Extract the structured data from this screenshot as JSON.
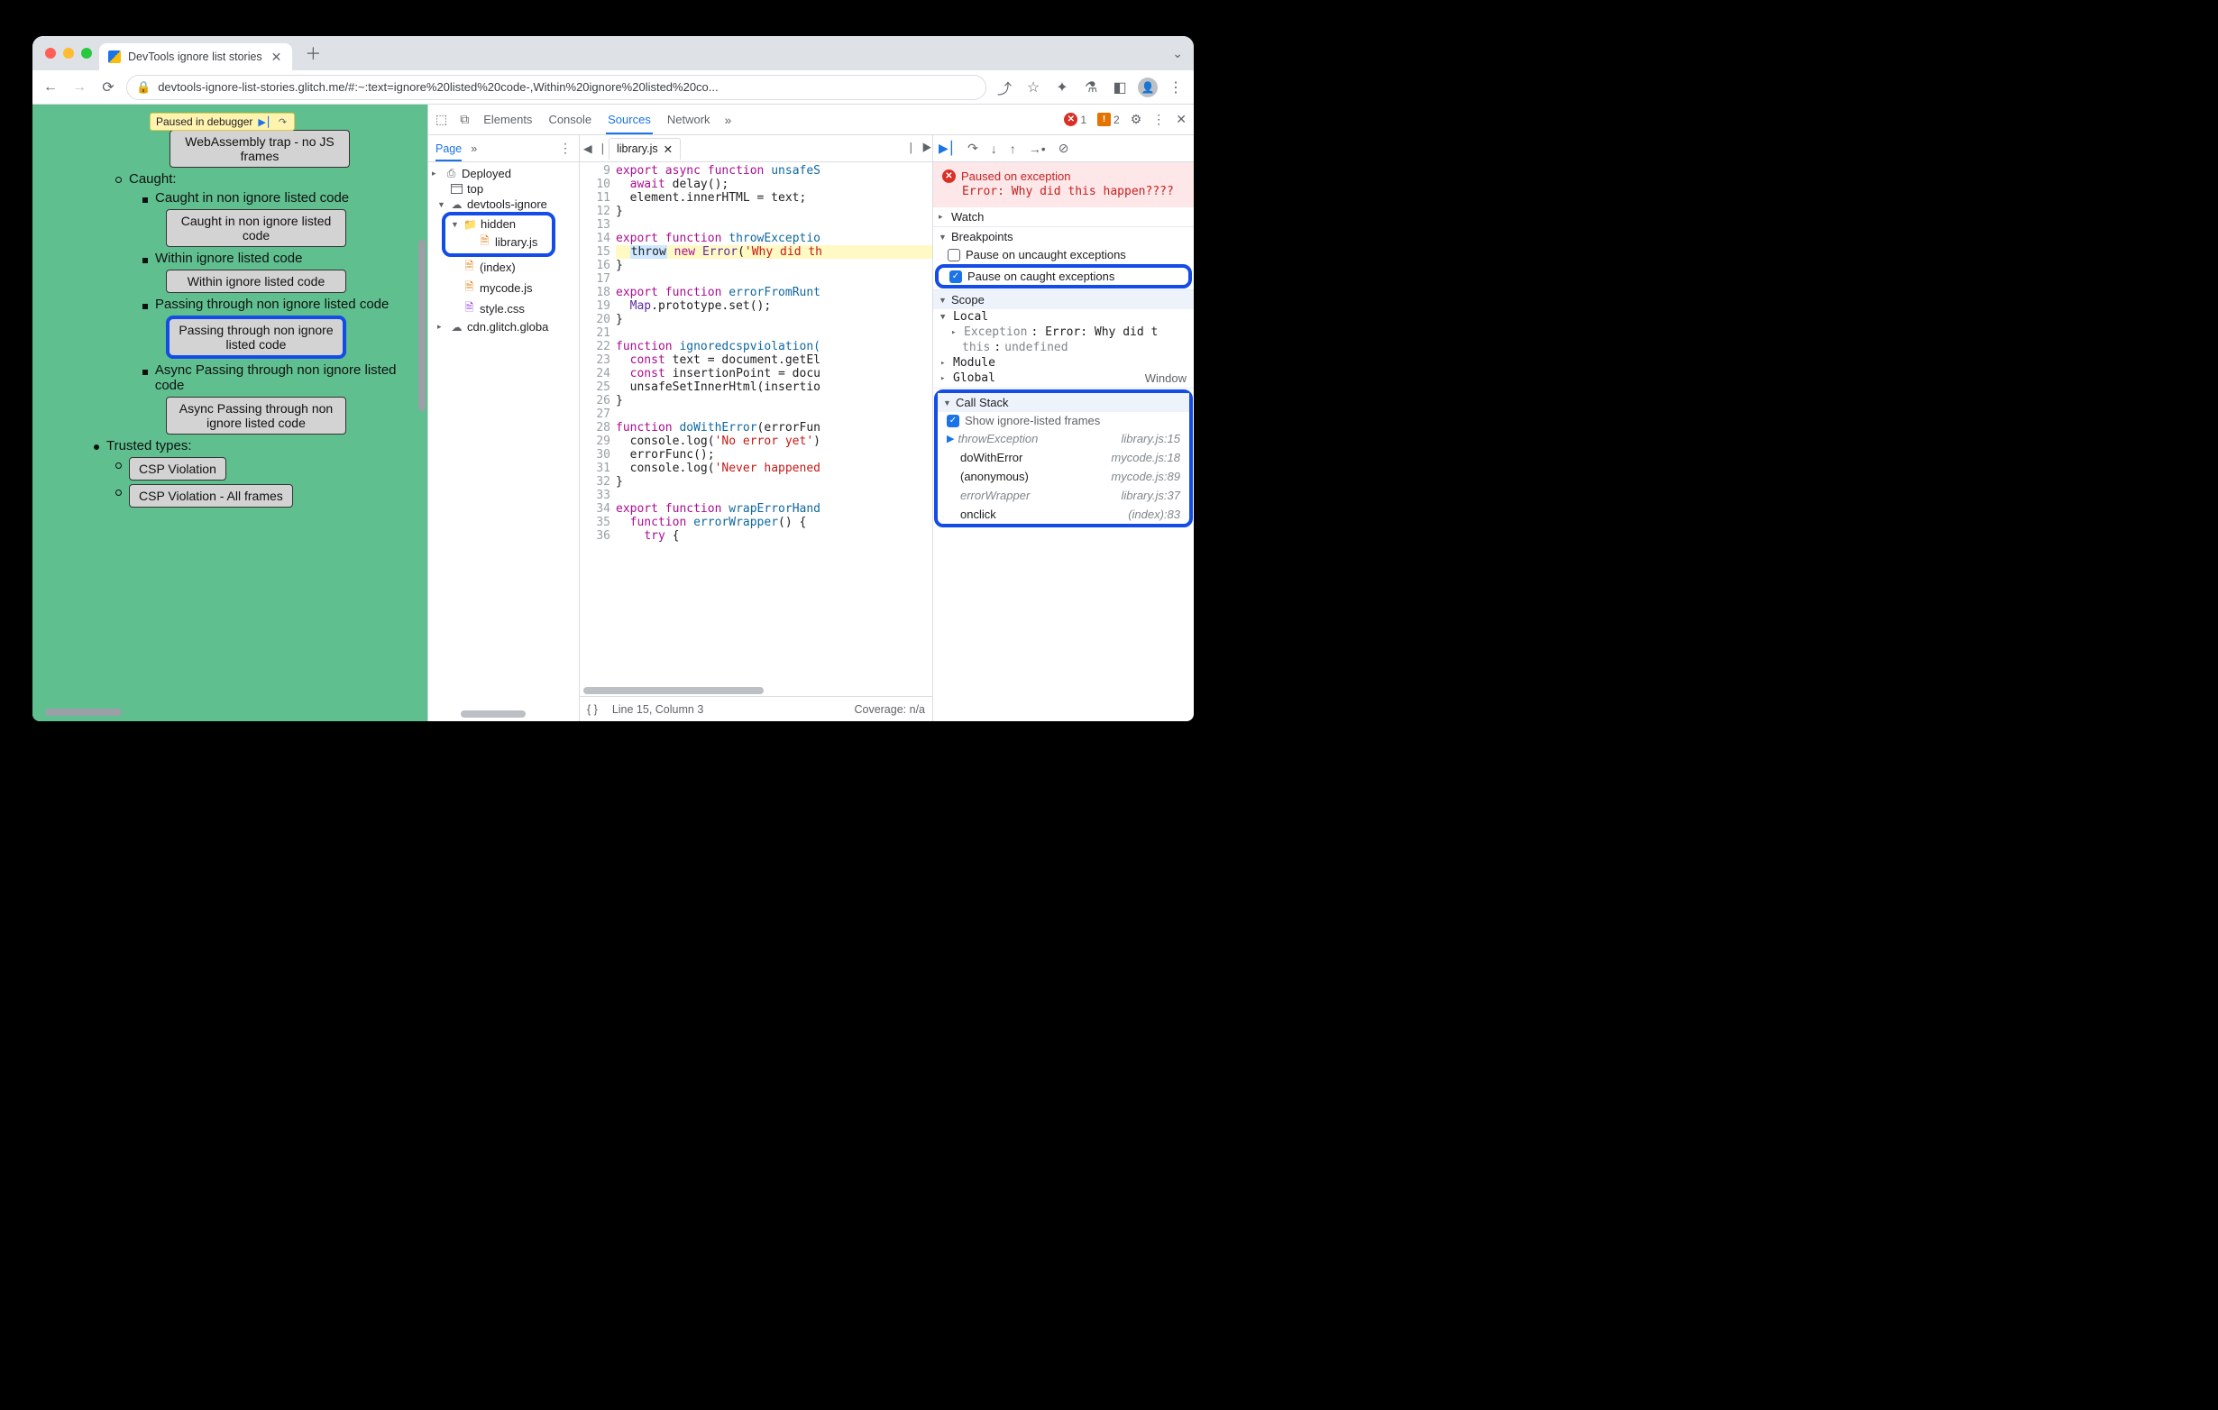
{
  "tab": {
    "title": "DevTools ignore list stories"
  },
  "url": "devtools-ignore-list-stories.glitch.me/#:~:text=ignore%20listed%20code-,Within%20ignore%20listed%20co...",
  "chip": {
    "text": "Paused in debugger"
  },
  "page": {
    "wasm": "WebAssembly trap - no JS frames",
    "caught": "Caught:",
    "l1": "Caught in non ignore listed code",
    "b1": "Caught in non ignore listed code",
    "l2": "Within ignore listed code",
    "b2": "Within ignore listed code",
    "l3": "Passing through non ignore listed code",
    "b3": "Passing through non ignore listed code",
    "l4": "Async Passing through non ignore listed code",
    "b4": "Async Passing through non ignore listed code",
    "tt": "Trusted types:",
    "b5": "CSP Violation",
    "b6": "CSP Violation - All frames"
  },
  "dtTabs": {
    "elements": "Elements",
    "console": "Console",
    "sources": "Sources",
    "network": "Network"
  },
  "errors": "1",
  "warnings": "2",
  "nav": {
    "page": "Page",
    "deployed": "Deployed",
    "top": "top",
    "domain": "devtools-ignore",
    "hidden": "hidden",
    "lib": "library.js",
    "index": "(index)",
    "mycode": "mycode.js",
    "style": "style.css",
    "cdn": "cdn.glitch.globa"
  },
  "editor": {
    "file": "library.js",
    "status_line": "Line 15, Column 3",
    "coverage": "Coverage: n/a",
    "lines": {
      "9": "export async function unsafeS",
      "10": "  await delay();",
      "11": "  element.innerHTML = text;",
      "12": "}",
      "13": "",
      "14": "export function throwExceptio",
      "15": "  throw new Error('Why did th",
      "16": "}",
      "17": "",
      "18": "export function errorFromRunt",
      "19": "  Map.prototype.set();",
      "20": "}",
      "21": "",
      "22": "function ignoredcspviolation(",
      "23": "  const text = document.getEl",
      "24": "  const insertionPoint = docu",
      "25": "  unsafeSetInnerHtml(insertio",
      "26": "}",
      "27": "",
      "28": "function doWithError(errorFun",
      "29": "  console.log('No error yet')",
      "30": "  errorFunc();",
      "31": "  console.log('Never happened",
      "32": "}",
      "33": "",
      "34": "export function wrapErrorHand",
      "35": "  function errorWrapper() {",
      "36": "    try {"
    }
  },
  "pause": {
    "title": "Paused on exception",
    "err": "Error: Why did this happen????"
  },
  "sections": {
    "watch": "Watch",
    "breakpoints": "Breakpoints",
    "scope": "Scope",
    "callstack": "Call Stack"
  },
  "bp": {
    "uncaught": "Pause on uncaught exceptions",
    "caught": "Pause on caught exceptions"
  },
  "scope": {
    "local": "Local",
    "exception": "Exception",
    "exval": ": Error: Why did t",
    "this": "this",
    "thisval": "undefined",
    "module": "Module",
    "global": "Global",
    "window": "Window"
  },
  "cs": {
    "show": "Show ignore-listed frames",
    "f1": "throwException",
    "l1": "library.js:15",
    "f2": "doWithError",
    "l2": "mycode.js:18",
    "f3": "(anonymous)",
    "l3": "mycode.js:89",
    "f4": "errorWrapper",
    "l4": "library.js:37",
    "f5": "onclick",
    "l5": "(index):83"
  }
}
